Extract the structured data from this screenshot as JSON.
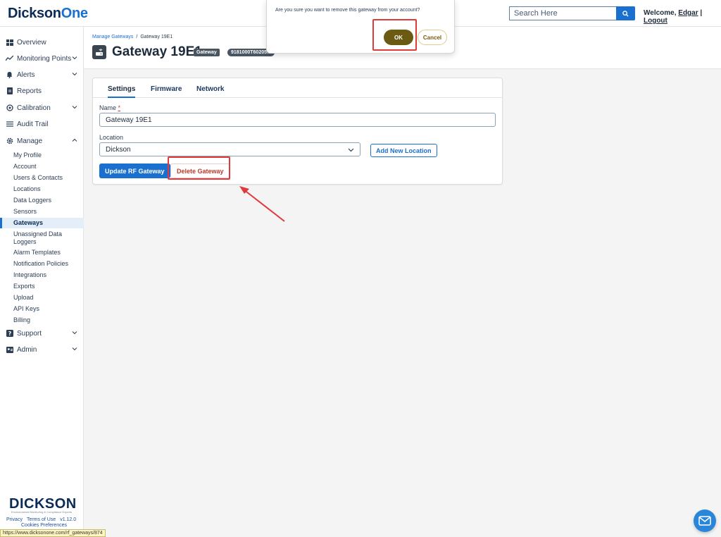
{
  "header": {
    "logo_main": "Dickson",
    "logo_accent": "One",
    "search_placeholder": "Search Here",
    "welcome_prefix": "Welcome, ",
    "user_name": "Edgar",
    "separator": " | ",
    "logout": "Logout"
  },
  "sidebar": {
    "items": [
      {
        "label": "Overview",
        "icon": "grid-icon"
      },
      {
        "label": "Monitoring Points",
        "icon": "trend-icon"
      },
      {
        "label": "Alerts",
        "icon": "bell-icon"
      },
      {
        "label": "Reports",
        "icon": "document-icon"
      },
      {
        "label": "Calibration",
        "icon": "target-icon"
      },
      {
        "label": "Audit Trail",
        "icon": "list-icon"
      },
      {
        "label": "Manage",
        "icon": "gear-icon"
      }
    ],
    "manage_sub": [
      "My Profile",
      "Account",
      "Users & Contacts",
      "Locations",
      "Data Loggers",
      "Sensors",
      "Gateways",
      "Unassigned Data Loggers",
      "Alarm Templates",
      "Notification Policies",
      "Integrations",
      "Exports",
      "Upload",
      "API Keys",
      "Billing"
    ],
    "active_sub": "Gateways",
    "bottom_items": [
      {
        "label": "Support",
        "icon": "question-icon"
      },
      {
        "label": "Admin",
        "icon": "id-card-icon"
      }
    ],
    "footer_logo": "DICKSON",
    "footer_tagline": "Environmental Monitoring & Compliance Experts",
    "footer_privacy": "Privacy",
    "footer_terms": "Terms of Use",
    "footer_version": "v1.12.0",
    "footer_cookies": "Cookies Preferences",
    "status_url": "https://www.dicksonone.com/rf_gateways/874"
  },
  "page": {
    "breadcrumb_parent": "Manage Gateways",
    "breadcrumb_sep": "/",
    "breadcrumb_current": "Gateway 19E1",
    "title": "Gateway 19E1",
    "type_badge": "Gateway",
    "serial_badge": "9181000T60205..."
  },
  "card": {
    "tabs": [
      "Settings",
      "Firmware",
      "Network"
    ],
    "active_tab": "Settings",
    "name_label": "Name",
    "name_required": "*",
    "name_value": "Gateway 19E1",
    "location_label": "Location",
    "location_value": "Dickson",
    "add_location": "Add New Location",
    "update_button": "Update RF Gateway",
    "delete_button": "Delete Gateway"
  },
  "dialog": {
    "message": "Are you sure you want to remove this gateway from your account?",
    "ok": "OK",
    "cancel": "Cancel"
  },
  "colors": {
    "brand_blue": "#1a6fcf",
    "navy": "#0a2a57",
    "danger": "#c0392b",
    "ok_olive": "#6a5a12",
    "highlight_red": "#e03a3a"
  }
}
